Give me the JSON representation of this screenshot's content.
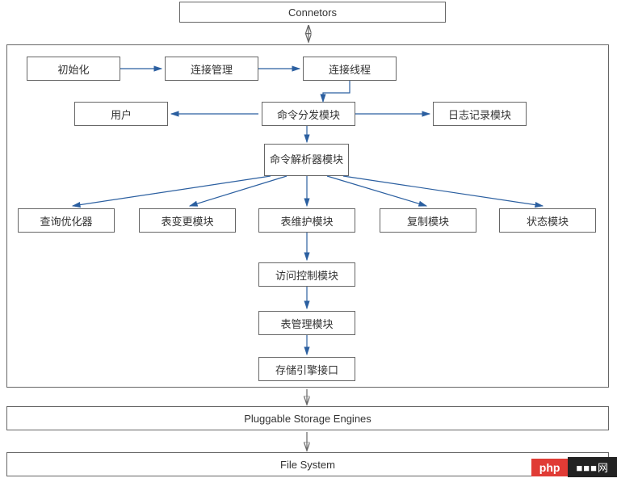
{
  "boxes": {
    "connectors": "Connetors",
    "init": "初始化",
    "conn_mgmt": "连接管理",
    "conn_thread": "连接线程",
    "user": "用户",
    "dispatch": "命令分发模块",
    "log": "日志记录模块",
    "parser": "命令解析器模块",
    "query_opt": "查询优化器",
    "table_change": "表变更模块",
    "table_maint": "表维护模块",
    "replication": "复制模块",
    "status": "状态模块",
    "access_ctrl": "访问控制模块",
    "table_mgmt": "表管理模块",
    "storage_iface": "存储引擎接口",
    "pluggable": "Pluggable Storage Engines",
    "filesystem": "File System"
  },
  "watermark": {
    "php": "php",
    "rest": "■■■网"
  }
}
